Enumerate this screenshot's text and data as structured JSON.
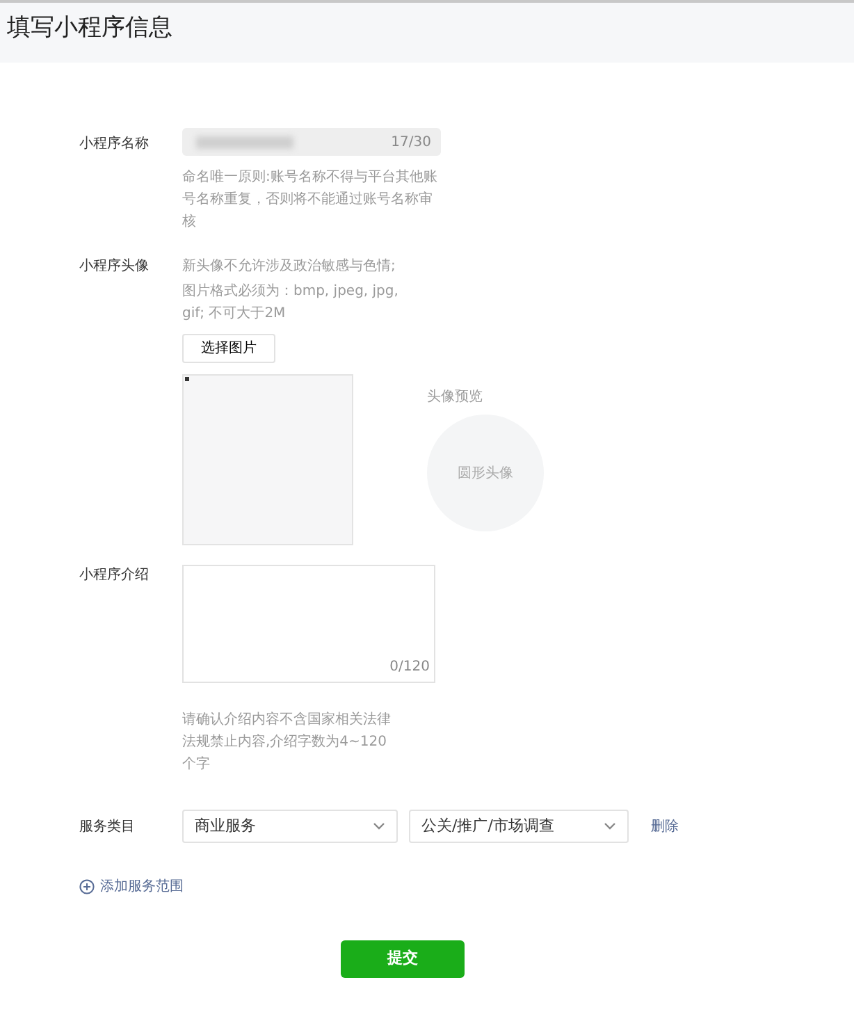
{
  "page_title": "填写小程序信息",
  "name_field": {
    "label": "小程序名称",
    "counter": "17/30",
    "hint": "命名唯一原则:账号名称不得与平台其他账号名称重复，否则将不能通过账号名称审核"
  },
  "avatar": {
    "label": "小程序头像",
    "hints": [
      "新头像不允许涉及政治敏感与色情;",
      "图片格式必须为：bmp, jpeg, jpg, gif; 不可大于2M"
    ],
    "choose_button": "选择图片",
    "preview_label": "头像预览",
    "preview_text": "圆形头像"
  },
  "intro": {
    "label": "小程序介绍",
    "counter": "0/120",
    "hint": "请确认介绍内容不含国家相关法律法规禁止内容,介绍字数为4~120个字"
  },
  "service": {
    "label": "服务类目",
    "selects": [
      {
        "value": "商业服务"
      },
      {
        "value": "公关/推广/市场调查"
      }
    ],
    "delete_link": "删除"
  },
  "add_scope_link": "添加服务范围",
  "submit_button": "提交"
}
